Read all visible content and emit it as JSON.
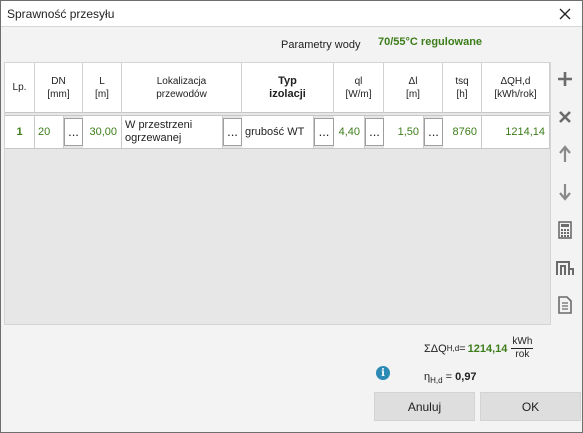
{
  "window": {
    "title": "Sprawność przesyłu"
  },
  "params": {
    "label": "Parametry wody",
    "value": "70/55°C regulowane"
  },
  "table": {
    "headers": {
      "lp": "Lp.",
      "dn": "DN\n[mm]",
      "l": "L\n[m]",
      "lok": "Lokalizacja\nprzewodów",
      "typ": "Typ\nizolacji",
      "ql": "ql\n[W/m]",
      "dl": "Δl\n[m]",
      "tsq": "tsq\n[h]",
      "dqh": "ΔQH,d\n[kWh/rok]"
    },
    "rows": [
      {
        "lp": "1",
        "dn": "20",
        "l": "30,00",
        "lok": "W przestrzeni ogrzewanej",
        "typ": "grubość WT",
        "ql": "4,40",
        "dl": "1,50",
        "tsq": "8760",
        "dqh": "1214,14"
      }
    ],
    "picker_label": "..."
  },
  "summary": {
    "sum_label": "ΣΔQ",
    "sum_sub": "H,d",
    "sum_eq": "=",
    "sum_value": "1214,14",
    "unit_num": "kWh",
    "unit_den": "rok",
    "eta_label": "η",
    "eta_sub": "H,d",
    "eta_eq": "=",
    "eta_value": "0,97",
    "info_glyph": "i"
  },
  "buttons": {
    "cancel": "Anuluj",
    "ok": "OK"
  },
  "colors": {
    "accent_green": "#3c7d1a",
    "info_blue": "#2c8bb5"
  },
  "icons": [
    "close-icon",
    "add-icon",
    "delete-icon",
    "move-up-icon",
    "move-down-icon",
    "calculator-icon",
    "pipe-icon",
    "copy-icon",
    "info-icon"
  ]
}
